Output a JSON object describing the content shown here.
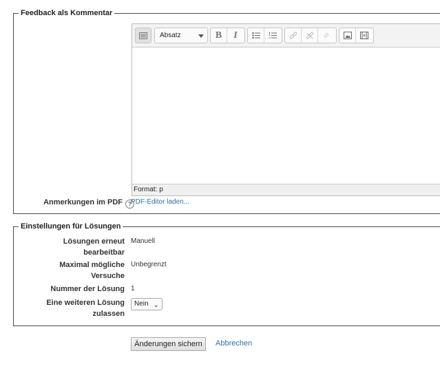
{
  "feedback": {
    "legend": "Feedback als Kommentar",
    "editor": {
      "format_select": "Absatz",
      "status": "Format: p",
      "toolbar": {
        "toggle_icon": "toolbar-toggle-icon",
        "bold_label": "B",
        "italic_label": "I"
      }
    },
    "pdf_label": "Anmerkungen im PDF",
    "pdf_link": "PDF-Editor laden..."
  },
  "solutions": {
    "legend": "Einstellungen für Lösungen",
    "rows": [
      {
        "label_1": "Lösungen erneut",
        "label_2": "bearbeitbar",
        "value": "Manuell"
      },
      {
        "label_1": "Maximal mögliche",
        "label_2": "Versuche",
        "value": "Unbegrenzt"
      },
      {
        "label_1": "Nummer der Lösung",
        "label_2": "",
        "value": "1"
      },
      {
        "label_1": "Eine weiteren Lösung",
        "label_2": "zulassen",
        "value": "Nein"
      }
    ]
  },
  "actions": {
    "save": "Änderungen sichern",
    "cancel": "Abbrechen"
  }
}
